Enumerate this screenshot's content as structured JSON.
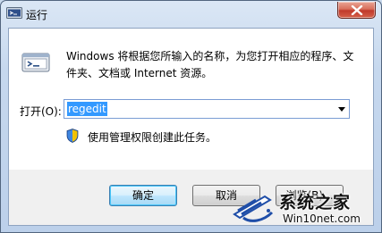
{
  "window": {
    "title": "运行",
    "close_icon": "close-icon"
  },
  "dialog": {
    "description": "Windows 将根据您所输入的名称，为您打开相应的程序、文件夹、文档或 Internet 资源。",
    "open_label": "打开(O):",
    "open_value": "regedit",
    "admin_note": "使用管理权限创建此任务。",
    "icons": [
      "run-program-icon",
      "uac-shield-icon",
      "dropdown-arrow-icon"
    ]
  },
  "buttons": {
    "ok": "确定",
    "cancel": "取消",
    "browse": "浏览(B)..."
  },
  "watermark": {
    "title": "系统之家",
    "url": "Win10net.com"
  },
  "colors": {
    "accent_selection": "#3399ff",
    "close_button": "#c0392b",
    "frame": "#bcd0ea"
  }
}
